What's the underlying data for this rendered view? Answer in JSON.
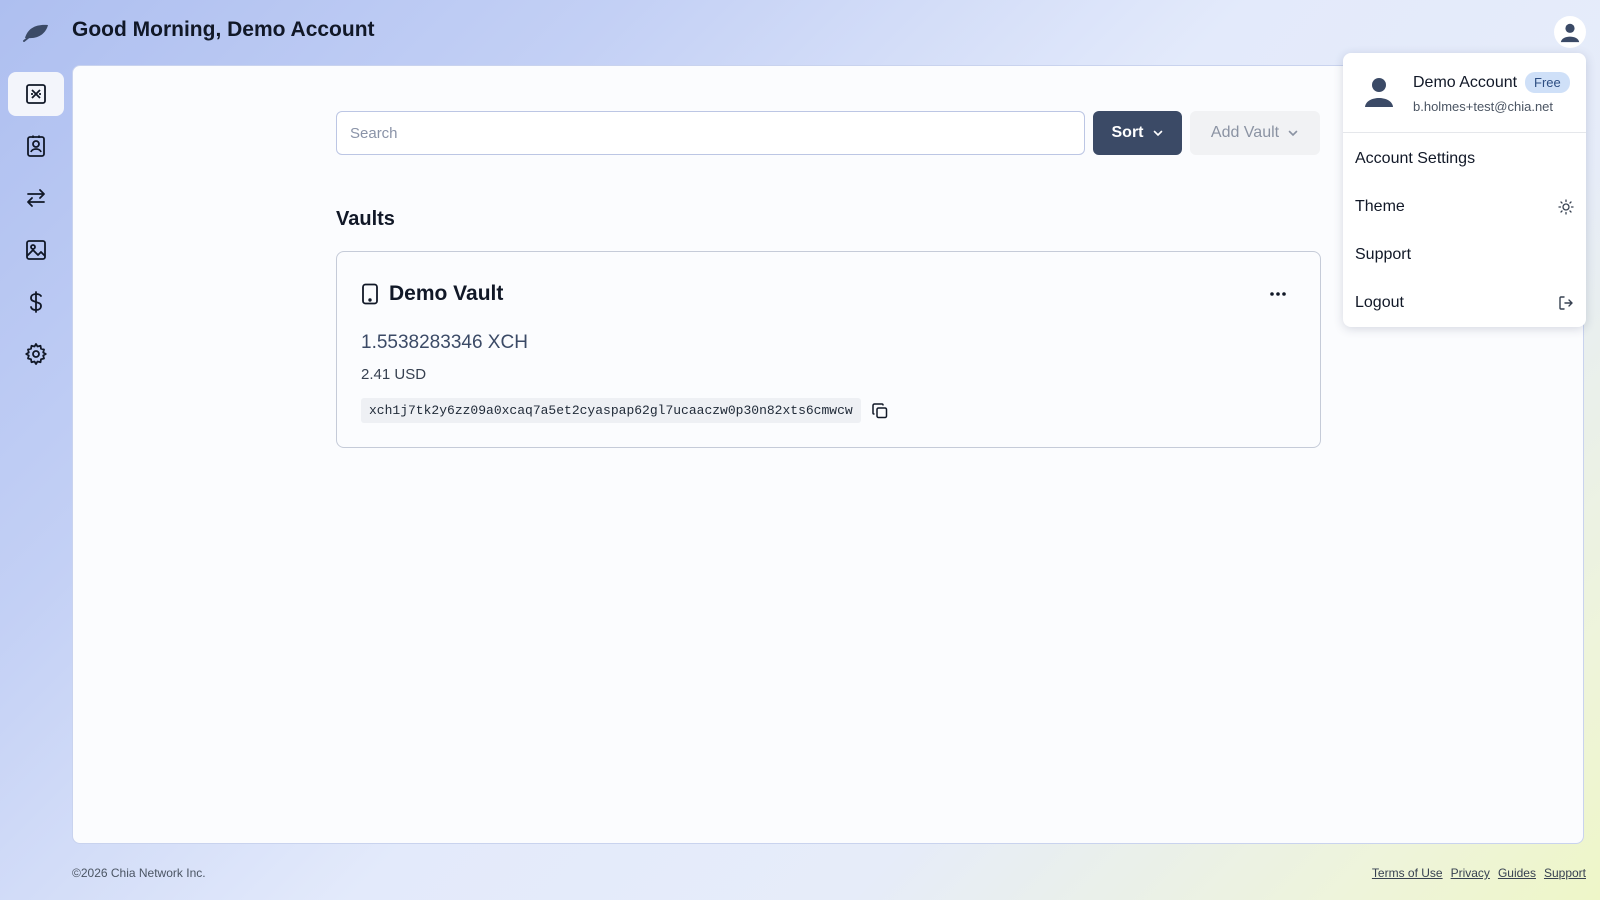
{
  "header": {
    "greeting": "Good Morning, Demo Account",
    "logo_icon": "leaf-icon",
    "avatar_icon": "user-icon"
  },
  "sidebar": {
    "items": [
      {
        "icon": "chia-logo-icon",
        "active": true
      },
      {
        "icon": "contacts-icon",
        "active": false
      },
      {
        "icon": "transfer-arrows-icon",
        "active": false
      },
      {
        "icon": "image-icon",
        "active": false
      },
      {
        "icon": "dollar-icon",
        "active": false
      },
      {
        "icon": "gear-icon",
        "active": false
      }
    ]
  },
  "toolbar": {
    "search_placeholder": "Search",
    "sort_label": "Sort",
    "add_vault_label": "Add Vault"
  },
  "vaults": {
    "title": "Vaults",
    "items": [
      {
        "name": "Demo Vault",
        "balance": "1.5538283346 XCH",
        "usd": "2.41 USD",
        "address": "xch1j7tk2y6zz09a0xcaq7a5et2cyaspap62gl7ucaaczw0p30n82xts6cmwcw"
      }
    ]
  },
  "account_menu": {
    "name": "Demo Account",
    "plan_badge": "Free",
    "email": "b.holmes+test@chia.net",
    "items": [
      {
        "label": "Account Settings",
        "icon": ""
      },
      {
        "label": "Theme",
        "icon": "sun-icon"
      },
      {
        "label": "Support",
        "icon": ""
      },
      {
        "label": "Logout",
        "icon": "logout-icon"
      }
    ]
  },
  "footer": {
    "copyright": "©2026 Chia Network Inc.",
    "links": [
      "Terms of Use",
      "Privacy",
      "Guides",
      "Support"
    ]
  },
  "colors": {
    "primary_button": "#3b4a66",
    "badge_bg": "#cfe0f8",
    "panel_bg": "#fbfcfe"
  }
}
